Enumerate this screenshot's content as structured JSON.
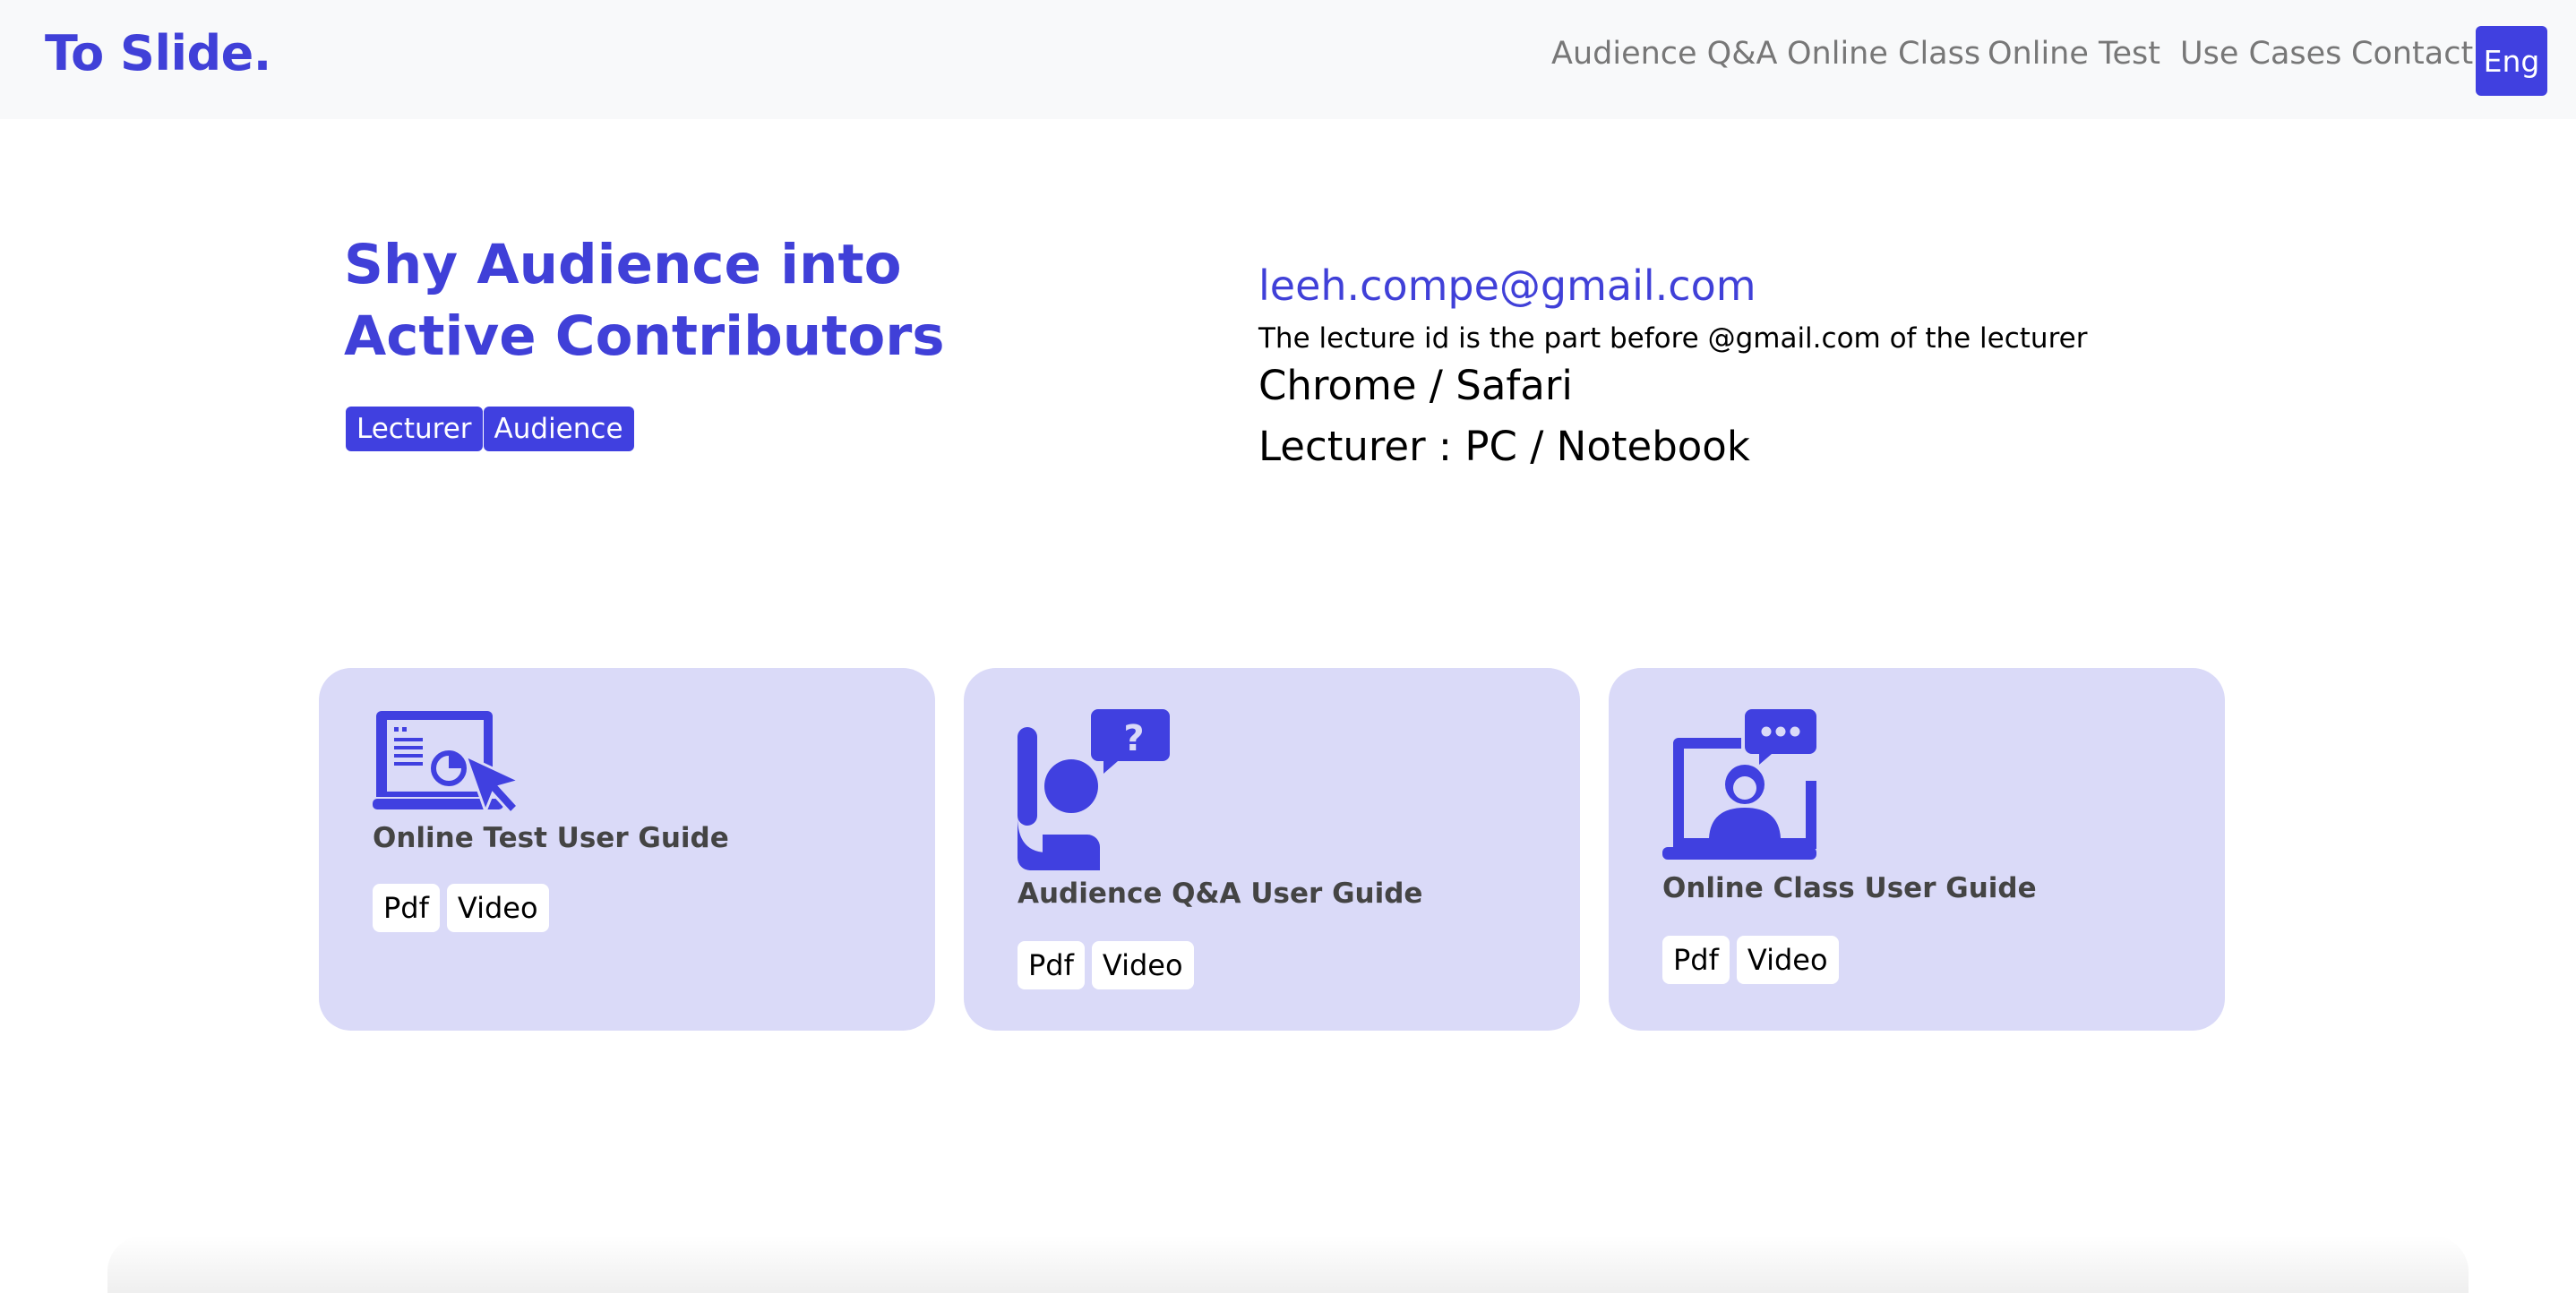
{
  "brand": "To Slide.",
  "nav": {
    "links": [
      "Audience Q&A",
      "Online Class",
      "Online Test",
      "Use Cases",
      "Contact"
    ],
    "lang": "Eng"
  },
  "hero": {
    "title_line1": "Shy Audience into",
    "title_line2": "Active Contributors",
    "tags": [
      "Lecturer",
      "Audience"
    ],
    "email": "leeh.compe@gmail.com",
    "note": "The lecture id is the part before @gmail.com of the lecturer",
    "browser_req": "Chrome / Safari",
    "device_req": "Lecturer : PC / Notebook"
  },
  "cards": [
    {
      "title": "Online Test User Guide",
      "icon": "laptop-chart-icon",
      "buttons": [
        "Pdf",
        "Video"
      ]
    },
    {
      "title": "Audience Q&A User Guide",
      "icon": "raised-hand-question-icon",
      "buttons": [
        "Pdf",
        "Video"
      ]
    },
    {
      "title": "Online Class User Guide",
      "icon": "laptop-presenter-chat-icon",
      "buttons": [
        "Pdf",
        "Video"
      ]
    }
  ],
  "colors": {
    "accent": "#4040e0",
    "card_bg": "#dadaf8",
    "nav_bg": "#f8f9fa"
  }
}
